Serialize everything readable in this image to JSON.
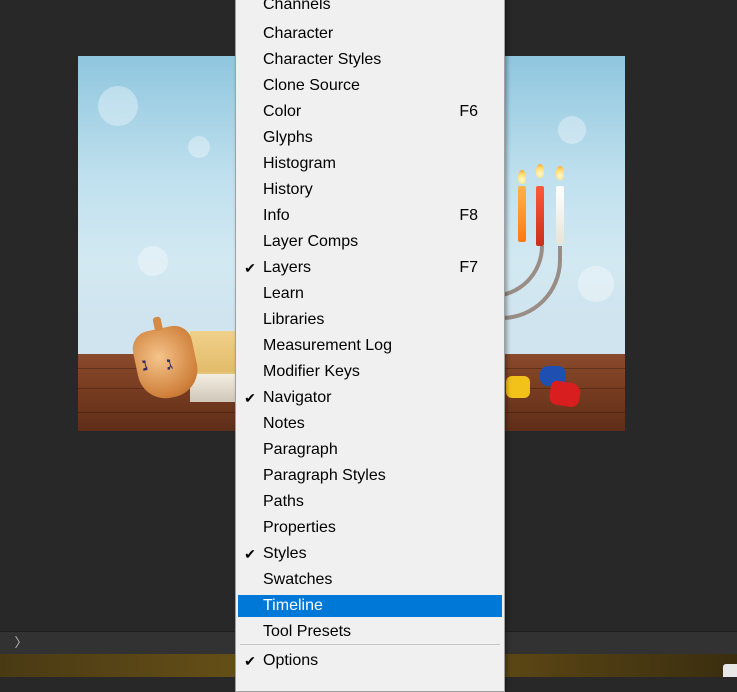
{
  "menu": {
    "items": [
      {
        "label": "Channels",
        "shortcut": "",
        "checked": false
      },
      {
        "label": "Character",
        "shortcut": "",
        "checked": false
      },
      {
        "label": "Character Styles",
        "shortcut": "",
        "checked": false
      },
      {
        "label": "Clone Source",
        "shortcut": "",
        "checked": false
      },
      {
        "label": "Color",
        "shortcut": "F6",
        "checked": false
      },
      {
        "label": "Glyphs",
        "shortcut": "",
        "checked": false
      },
      {
        "label": "Histogram",
        "shortcut": "",
        "checked": false
      },
      {
        "label": "History",
        "shortcut": "",
        "checked": false
      },
      {
        "label": "Info",
        "shortcut": "F8",
        "checked": false
      },
      {
        "label": "Layer Comps",
        "shortcut": "",
        "checked": false
      },
      {
        "label": "Layers",
        "shortcut": "F7",
        "checked": true
      },
      {
        "label": "Learn",
        "shortcut": "",
        "checked": false
      },
      {
        "label": "Libraries",
        "shortcut": "",
        "checked": false
      },
      {
        "label": "Measurement Log",
        "shortcut": "",
        "checked": false
      },
      {
        "label": "Modifier Keys",
        "shortcut": "",
        "checked": false
      },
      {
        "label": "Navigator",
        "shortcut": "",
        "checked": true
      },
      {
        "label": "Notes",
        "shortcut": "",
        "checked": false
      },
      {
        "label": "Paragraph",
        "shortcut": "",
        "checked": false
      },
      {
        "label": "Paragraph Styles",
        "shortcut": "",
        "checked": false
      },
      {
        "label": "Paths",
        "shortcut": "",
        "checked": false
      },
      {
        "label": "Properties",
        "shortcut": "",
        "checked": false
      },
      {
        "label": "Styles",
        "shortcut": "",
        "checked": true
      },
      {
        "label": "Swatches",
        "shortcut": "",
        "checked": false
      },
      {
        "label": "Timeline",
        "shortcut": "",
        "checked": false,
        "highlighted": true
      },
      {
        "label": "Tool Presets",
        "shortcut": "",
        "checked": false
      }
    ],
    "options": {
      "label": "Options",
      "checked": true
    },
    "check_glyph": "✔",
    "highlight_color": "#0078d7"
  },
  "status_bar": {
    "toggle_glyph": "〉"
  },
  "canvas": {
    "glyph_1": "נ",
    "glyph_2": "ג"
  }
}
